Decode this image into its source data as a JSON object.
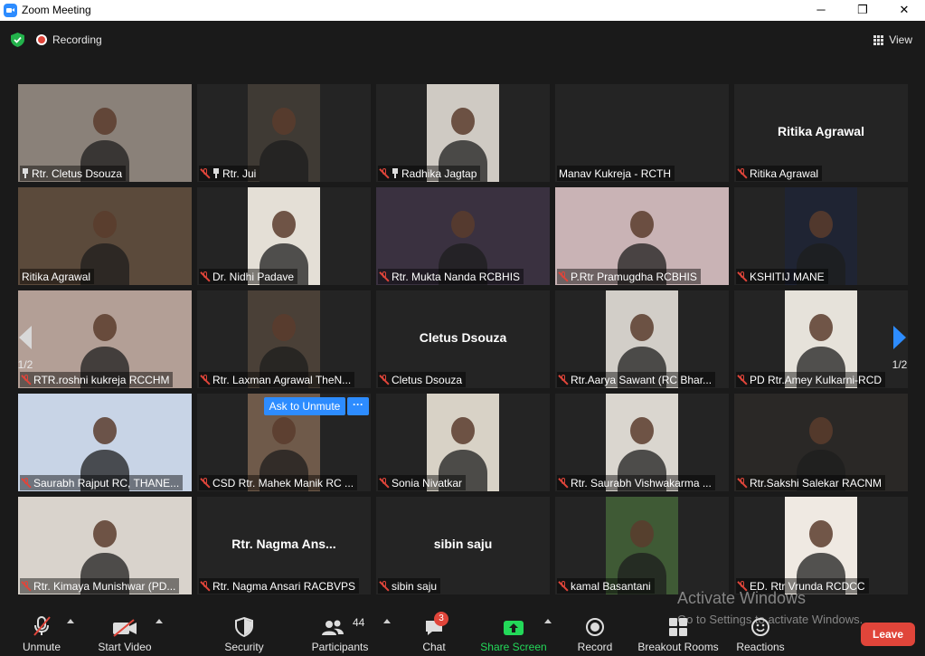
{
  "window": {
    "title": "Zoom Meeting",
    "minimize": "─",
    "maximize": "❐",
    "close": "✕"
  },
  "topbar": {
    "recording_label": "Recording",
    "view_label": "View"
  },
  "pager": {
    "left_page": "1/2",
    "right_page": "1/2"
  },
  "tiles": [
    {
      "name": "Rtr. Cletus Dsouza",
      "muted": false,
      "pinned": true,
      "video": true,
      "bg": "#8a8179",
      "center": ""
    },
    {
      "name": "Rtr. Jui",
      "muted": true,
      "pinned": true,
      "video": true,
      "bg": "#3f3a34",
      "center": ""
    },
    {
      "name": "Radhika Jagtap",
      "muted": true,
      "pinned": true,
      "video": true,
      "bg": "#cfcac3",
      "center": ""
    },
    {
      "name": "Manav Kukreja - RCTH",
      "muted": false,
      "pinned": false,
      "video": false,
      "bg": "",
      "center": ""
    },
    {
      "name": "Ritika Agrawal",
      "muted": true,
      "pinned": false,
      "video": false,
      "bg": "",
      "center": "Ritika Agrawal"
    },
    {
      "name": "Ritika Agrawal",
      "muted": false,
      "pinned": false,
      "video": true,
      "bg": "#5b4a3b",
      "center": "",
      "active": true
    },
    {
      "name": "Dr. Nidhi Padave",
      "muted": true,
      "pinned": false,
      "video": true,
      "bg": "#e4dfd6",
      "center": ""
    },
    {
      "name": "Rtr. Mukta Nanda RCBHIS",
      "muted": true,
      "pinned": false,
      "video": true,
      "bg": "#3a3140",
      "center": ""
    },
    {
      "name": "P.Rtr Pramugdha RCBHIS",
      "muted": true,
      "pinned": false,
      "video": true,
      "bg": "#c9b3b5",
      "center": ""
    },
    {
      "name": "KSHITIJ MANE",
      "muted": true,
      "pinned": false,
      "video": true,
      "bg": "#1f2433",
      "center": ""
    },
    {
      "name": "RTR.roshni kukreja RCCHM",
      "muted": true,
      "pinned": false,
      "video": true,
      "bg": "#b39f96",
      "center": ""
    },
    {
      "name": "Rtr. Laxman Agrawal TheN...",
      "muted": true,
      "pinned": false,
      "video": true,
      "bg": "#4a4037",
      "center": ""
    },
    {
      "name": "Cletus Dsouza",
      "muted": true,
      "pinned": false,
      "video": false,
      "bg": "",
      "center": "Cletus Dsouza"
    },
    {
      "name": "Rtr.Aarya Sawant (RC Bhar...",
      "muted": true,
      "pinned": false,
      "video": true,
      "bg": "#d2cec8",
      "center": ""
    },
    {
      "name": "PD Rtr.Amey Kulkarni-RCD",
      "muted": true,
      "pinned": false,
      "video": true,
      "bg": "#e6e2da",
      "center": ""
    },
    {
      "name": "Saurabh Rajput RC, THANE...",
      "muted": true,
      "pinned": false,
      "video": true,
      "bg": "#c8d4e6",
      "center": ""
    },
    {
      "name": "CSD Rtr. Mahek Manik RC ...",
      "muted": true,
      "pinned": false,
      "video": true,
      "bg": "#6f5a4a",
      "center": ""
    },
    {
      "name": "Sonia Nivatkar",
      "muted": true,
      "pinned": false,
      "video": true,
      "bg": "#d8d2c6",
      "center": ""
    },
    {
      "name": "Rtr. Saurabh Vishwakarma ...",
      "muted": true,
      "pinned": false,
      "video": true,
      "bg": "#dad6cf",
      "center": ""
    },
    {
      "name": "Rtr.Sakshi Salekar RACNM",
      "muted": true,
      "pinned": false,
      "video": true,
      "bg": "#2a2826",
      "center": ""
    },
    {
      "name": "Rtr. Kimaya Munishwar (PD...",
      "muted": true,
      "pinned": false,
      "video": true,
      "bg": "#d9d3cc",
      "center": ""
    },
    {
      "name": "Rtr. Nagma Ansari RACBVPS",
      "muted": true,
      "pinned": false,
      "video": false,
      "bg": "",
      "center": "Rtr. Nagma Ans..."
    },
    {
      "name": "sibin saju",
      "muted": true,
      "pinned": false,
      "video": false,
      "bg": "",
      "center": "sibin saju"
    },
    {
      "name": "kamal Basantani",
      "muted": true,
      "pinned": false,
      "video": true,
      "bg": "#3f5a35",
      "center": ""
    },
    {
      "name": "ED. Rtr Vrunda RCDCC",
      "muted": true,
      "pinned": false,
      "video": true,
      "bg": "#efe9e2",
      "center": ""
    }
  ],
  "ask_to_unmute": {
    "label": "Ask to Unmute",
    "more": "···"
  },
  "watermark": {
    "line1": "Activate Windows",
    "line2": "Go to Settings to activate Windows."
  },
  "toolbar": {
    "unmute": "Unmute",
    "start_video": "Start Video",
    "security": "Security",
    "participants": "Participants",
    "participants_count": "44",
    "chat": "Chat",
    "chat_badge": "3",
    "share_screen": "Share Screen",
    "record": "Record",
    "breakout_rooms": "Breakout Rooms",
    "reactions": "Reactions",
    "leave": "Leave"
  },
  "colors": {
    "accent": "#2d8cff",
    "danger": "#e0453a",
    "share": "#23d959",
    "active_border": "#d9e26a"
  }
}
